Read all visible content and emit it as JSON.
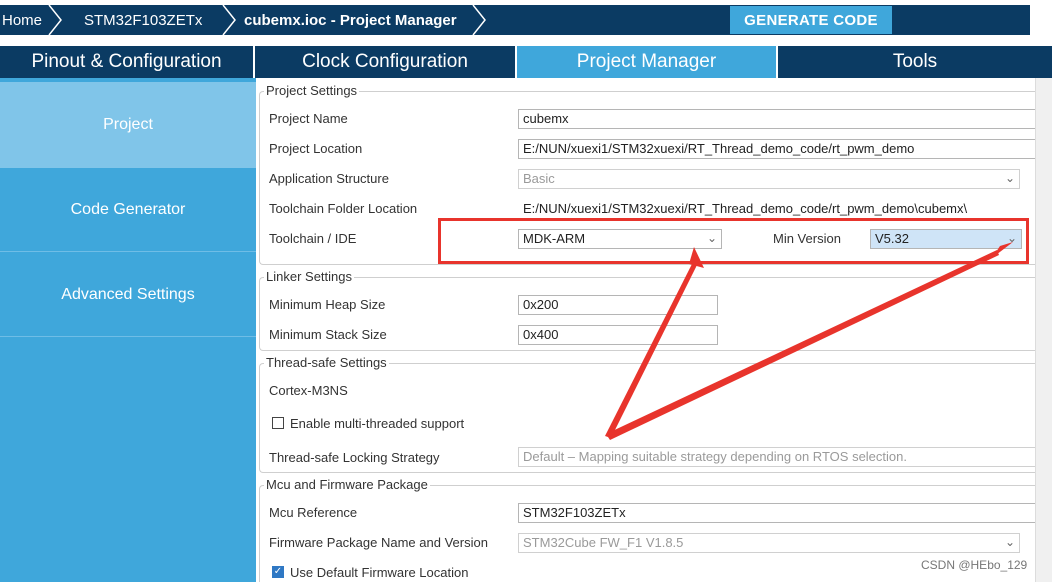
{
  "breadcrumb": {
    "home": "Home",
    "device": "STM32F103ZETx",
    "project": "cubemx.ioc - Project Manager"
  },
  "toolbar": {
    "generate_label": "GENERATE CODE"
  },
  "tabs": [
    {
      "label": "Pinout & Configuration"
    },
    {
      "label": "Clock Configuration"
    },
    {
      "label": "Project Manager"
    },
    {
      "label": "Tools"
    }
  ],
  "sidebar": {
    "items": [
      {
        "label": "Project"
      },
      {
        "label": "Code Generator"
      },
      {
        "label": "Advanced Settings"
      }
    ]
  },
  "project_settings": {
    "legend": "Project Settings",
    "name_label": "Project Name",
    "name_value": "cubemx",
    "location_label": "Project Location",
    "location_value": "E:/NUN/xuexi1/STM32xuexi/RT_Thread_demo_code/rt_pwm_demo",
    "structure_label": "Application Structure",
    "structure_value": "Basic",
    "toolchain_folder_label": "Toolchain Folder Location",
    "toolchain_folder_value": "E:/NUN/xuexi1/STM32xuexi/RT_Thread_demo_code/rt_pwm_demo\\cubemx\\",
    "toolchain_label": "Toolchain / IDE",
    "toolchain_value": "MDK-ARM",
    "min_version_label": "Min Version",
    "min_version_value": "V5.32"
  },
  "linker_settings": {
    "legend": "Linker Settings",
    "heap_label": "Minimum Heap Size",
    "heap_value": "0x200",
    "stack_label": "Minimum Stack Size",
    "stack_value": "0x400"
  },
  "thread_safe": {
    "legend": "Thread-safe Settings",
    "core": "Cortex-M3NS",
    "enable_label": "Enable multi-threaded support",
    "strategy_label": "Thread-safe Locking Strategy",
    "strategy_value": "Default  –  Mapping suitable strategy depending on RTOS selection."
  },
  "mcu_firmware": {
    "legend": "Mcu and Firmware Package",
    "mcu_ref_label": "Mcu Reference",
    "mcu_ref_value": "STM32F103ZETx",
    "fw_label": "Firmware Package Name and Version",
    "fw_value": "STM32Cube FW_F1 V1.8.5",
    "use_default_label": "Use Default Firmware Location"
  },
  "watermark": "CSDN @HEbo_129",
  "colors": {
    "navy": "#0b3b63",
    "accent_blue": "#3fa7db",
    "sidebar_selected": "#80c5e9",
    "annotation_red": "#e8342c"
  },
  "state": {
    "enable_multithread_checked": false,
    "use_default_fw_checked": true
  }
}
